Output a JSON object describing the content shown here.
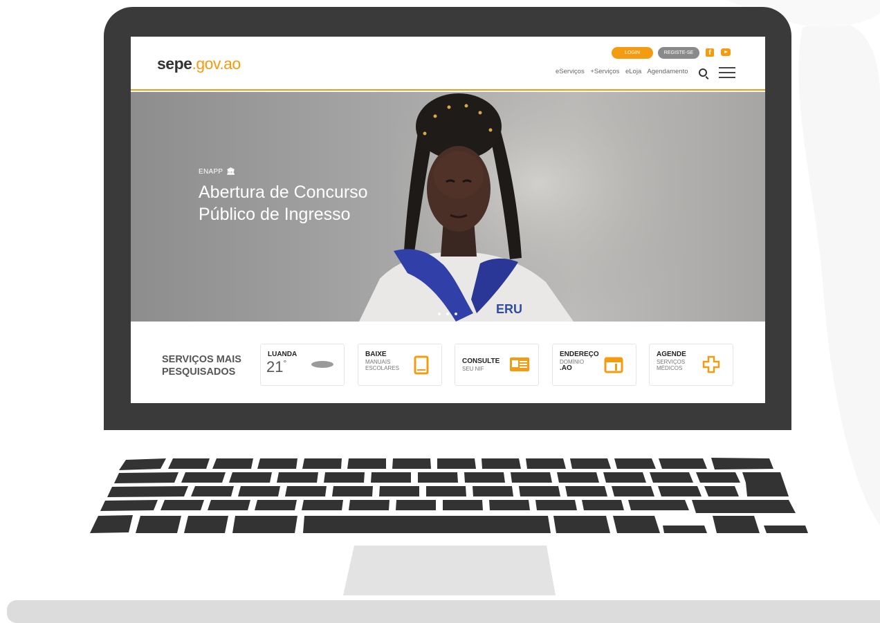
{
  "site": {
    "logo_bold": "sepe",
    "logo_rest": ".gov.ao"
  },
  "header": {
    "login": "LOGIN",
    "register": "REGISTE-SE",
    "facebook_icon": "facebook-icon",
    "youtube_icon": "youtube-icon",
    "nav": [
      "eServiços",
      "+Serviços",
      "eLoja",
      "Agendamento"
    ],
    "search_icon": "search-icon",
    "menu_icon": "hamburger-menu-icon"
  },
  "hero": {
    "kicker": "ENAPP",
    "title_line1": "Abertura de Concurso",
    "title_line2": "Público de Ingresso",
    "slides": 3,
    "badge_text": "ERU"
  },
  "services": {
    "heading_line1": "SERVIÇOS MAIS",
    "heading_line2": "PESQUISADOS",
    "cards": [
      {
        "title": "LUANDA",
        "value": "21",
        "unit": "°",
        "icon": "cloud-weather-icon"
      },
      {
        "title": "BAIXE",
        "sub1": "MANUAIS",
        "sub2": "ESCOLARES",
        "icon": "book-icon"
      },
      {
        "title": "CONSULTE",
        "sub1": "SEU NIF",
        "icon": "id-card-icon"
      },
      {
        "title": "ENDEREÇO",
        "sub1": "DOMÍNIO",
        "sub2": ".AO",
        "icon": "browser-window-icon"
      },
      {
        "title": "AGENDE",
        "sub1": "SERVIÇOS",
        "sub2": "MÉDICOS",
        "icon": "medical-cross-icon"
      }
    ]
  },
  "colors": {
    "accent": "#f39c12",
    "laptop_frame": "#3a3a3a",
    "keys": "#333333",
    "base": "#dcdcdc"
  }
}
